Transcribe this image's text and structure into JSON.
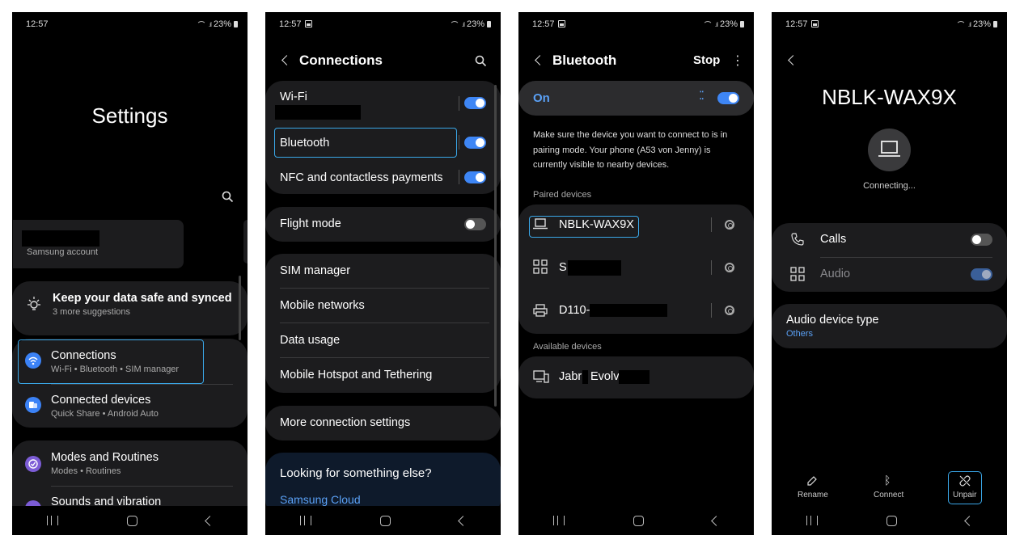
{
  "status_bar": {
    "time": "12:57",
    "battery": "23%"
  },
  "screen1": {
    "title": "Settings",
    "account_label": "Samsung account",
    "suggestion": {
      "title": "Keep your data safe and synced",
      "subtitle": "3 more suggestions"
    },
    "items": [
      {
        "title": "Connections",
        "sub": "Wi-Fi  •  Bluetooth  •  SIM manager",
        "color": "#3b82f6"
      },
      {
        "title": "Connected devices",
        "sub": "Quick Share  •  Android Auto",
        "color": "#3b82f6"
      },
      {
        "title": "Modes and Routines",
        "sub": "Modes  •  Routines",
        "color": "#7c5cd6"
      },
      {
        "title": "Sounds and vibration",
        "sub": "",
        "color": "#7c5cd6"
      }
    ]
  },
  "screen2": {
    "title": "Connections",
    "wifi": "Wi-Fi",
    "bluetooth": "Bluetooth",
    "nfc": "NFC and contactless payments",
    "flight": "Flight mode",
    "sim": "SIM manager",
    "mobile_networks": "Mobile networks",
    "data_usage": "Data usage",
    "hotspot": "Mobile Hotspot and Tethering",
    "more": "More connection settings",
    "looking": "Looking for something else?",
    "cloud": "Samsung Cloud"
  },
  "screen3": {
    "title": "Bluetooth",
    "stop": "Stop",
    "on": "On",
    "info": "Make sure the device you want to connect to is in pairing mode. Your phone (A53 von Jenny) is currently visible to nearby devices.",
    "paired_header": "Paired devices",
    "paired": [
      "NBLK-WAX9X",
      "S",
      "D110-"
    ],
    "available_header": "Available devices",
    "available_a": "Jabr",
    "available_b": "Evolv"
  },
  "screen4": {
    "device_name": "NBLK-WAX9X",
    "status": "Connecting...",
    "calls": "Calls",
    "audio": "Audio",
    "audio_type_title": "Audio device type",
    "audio_type_value": "Others",
    "actions": {
      "rename": "Rename",
      "connect": "Connect",
      "unpair": "Unpair"
    }
  },
  "colors": {
    "accent": "#3e86f5",
    "highlight": "#3aa7e8",
    "link": "#5aa0f5"
  }
}
